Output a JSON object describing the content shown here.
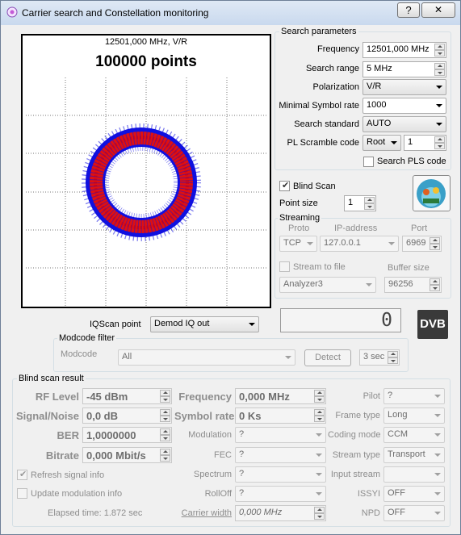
{
  "window": {
    "title": "Carrier search and Constellation monitoring",
    "help_label": "?",
    "close_label": "✕"
  },
  "plot": {
    "header": "12501,000 MHz, V/R",
    "points": "100000 points"
  },
  "search": {
    "group_title": "Search parameters",
    "frequency_label": "Frequency",
    "frequency_value": "12501,000 MHz",
    "range_label": "Search range",
    "range_value": "5 MHz",
    "polarization_label": "Polarization",
    "polarization_value": "V/R",
    "symrate_label": "Minimal Symbol rate",
    "symrate_value": "1000",
    "standard_label": "Search standard",
    "standard_value": "AUTO",
    "pls_label": "PL Scramble code",
    "pls_type": "Root",
    "pls_value": "1",
    "search_pls_label": "Search PLS code"
  },
  "blind": {
    "label": "Blind Scan",
    "pointsize_label": "Point size",
    "pointsize_value": "1"
  },
  "streaming": {
    "group_title": "Streaming",
    "proto_header": "Proto",
    "ip_header": "IP-address",
    "port_header": "Port",
    "proto_value": "TCP",
    "ip_value": "127.0.0.1",
    "port_value": "6969",
    "stream_to_file_label": "Stream to file",
    "buffer_label": "Buffer size",
    "file_value": "Analyzer3",
    "buffer_value": "96256"
  },
  "iq": {
    "label": "IQScan point",
    "value": "Demod IQ out",
    "counter": "0",
    "dvb_logo": "DVB"
  },
  "modcode": {
    "group_title": "Modcode filter",
    "label": "Modcode",
    "value": "All",
    "detect_label": "Detect",
    "interval_value": "3 sec"
  },
  "result": {
    "group_title": "Blind scan result",
    "rf_label": "RF Level",
    "rf_value": "-45 dBm",
    "sn_label": "Signal/Noise",
    "sn_value": "0,0 dB",
    "ber_label": "BER",
    "ber_value": "1,0000000",
    "bitrate_label": "Bitrate",
    "bitrate_value": "0,000 Mbit/s",
    "freq_label": "Frequency",
    "freq_value": "0,000 MHz",
    "symrate_label": "Symbol rate",
    "symrate_value": "0 Ks",
    "modulation_label": "Modulation",
    "modulation_value": "?",
    "fec_label": "FEC",
    "fec_value": "?",
    "spectrum_label": "Spectrum",
    "spectrum_value": "?",
    "rolloff_label": "RollOff",
    "rolloff_value": "?",
    "carrier_width_label": "Carrier width",
    "carrier_width_value": "0,000 MHz",
    "pilot_label": "Pilot",
    "pilot_value": "?",
    "frame_label": "Frame type",
    "frame_value": "Long",
    "coding_label": "Coding mode",
    "coding_value": "CCM",
    "stream_type_label": "Stream type",
    "stream_type_value": "Transport",
    "input_stream_label": "Input stream",
    "input_stream_value": "",
    "issyi_label": "ISSYI",
    "issyi_value": "OFF",
    "npd_label": "NPD",
    "npd_value": "OFF",
    "refresh_label": "Refresh signal info",
    "update_mod_label": "Update modulation info",
    "elapsed": "Elapsed time: 1.872 sec"
  },
  "colors": {
    "ring_outer": "#0000ff",
    "ring_inner": "#ff0000",
    "accent_bg": "#c9d9ee"
  }
}
